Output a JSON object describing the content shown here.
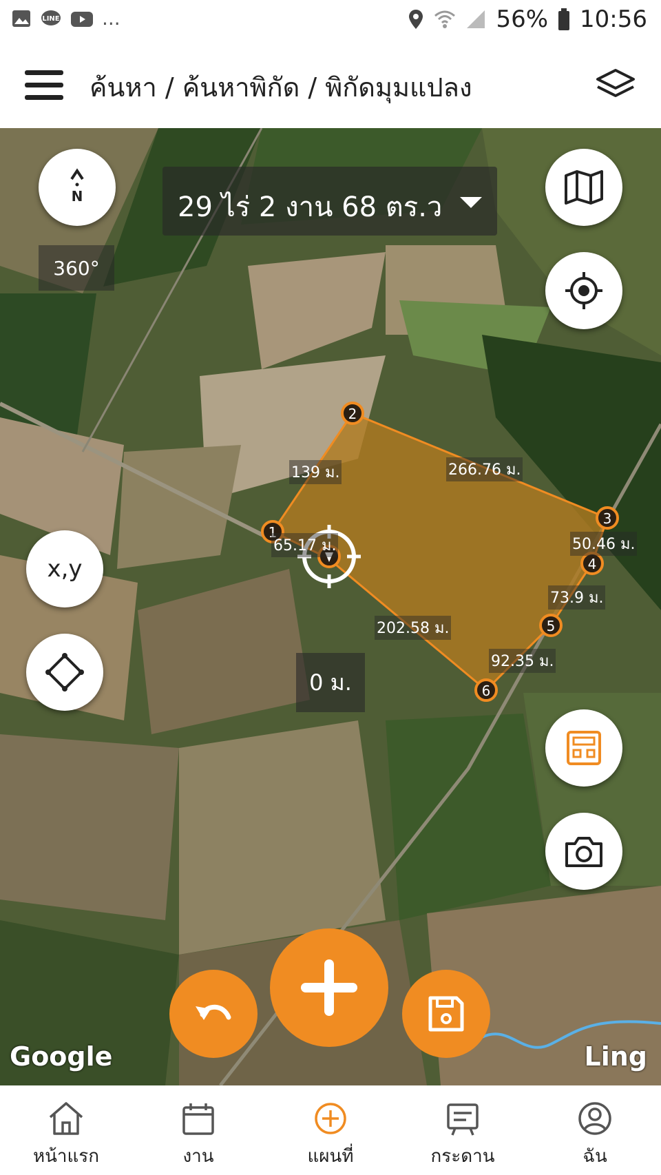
{
  "status_bar": {
    "battery": "56%",
    "time": "10:56",
    "more": "..."
  },
  "header": {
    "title": "ค้นหา / ค้นหาพิกัด / พิกัดมุมแปลง"
  },
  "map": {
    "area": "29 ไร่ 2 งาน 68 ตร.ว",
    "heading": "360°",
    "compass": "N",
    "distance": "0 ม.",
    "xy_label": "x,y",
    "attribution": "Google",
    "overlay_text": "Ling",
    "points": [
      "1",
      "2",
      "3",
      "4",
      "5",
      "6"
    ],
    "segments": {
      "s12": "139 ม.",
      "s23": "266.76 ม.",
      "s34": "50.46 ม.",
      "s45": "73.9 ม.",
      "s56": "92.35 ม.",
      "s6c": "202.58 ม.",
      "sc1": "65.17 ม."
    },
    "colors": {
      "accent": "#f08c22",
      "polygon_fill": "#b07a20"
    }
  },
  "bottom_nav": {
    "items": [
      {
        "label": "หน้าแรก",
        "icon": "home-icon"
      },
      {
        "label": "งาน",
        "icon": "calendar-icon"
      },
      {
        "label": "แผนที่",
        "icon": "plus-circle-icon"
      },
      {
        "label": "กระดาน",
        "icon": "board-icon"
      },
      {
        "label": "ฉัน",
        "icon": "user-icon"
      }
    ],
    "active": "แผนที่"
  }
}
